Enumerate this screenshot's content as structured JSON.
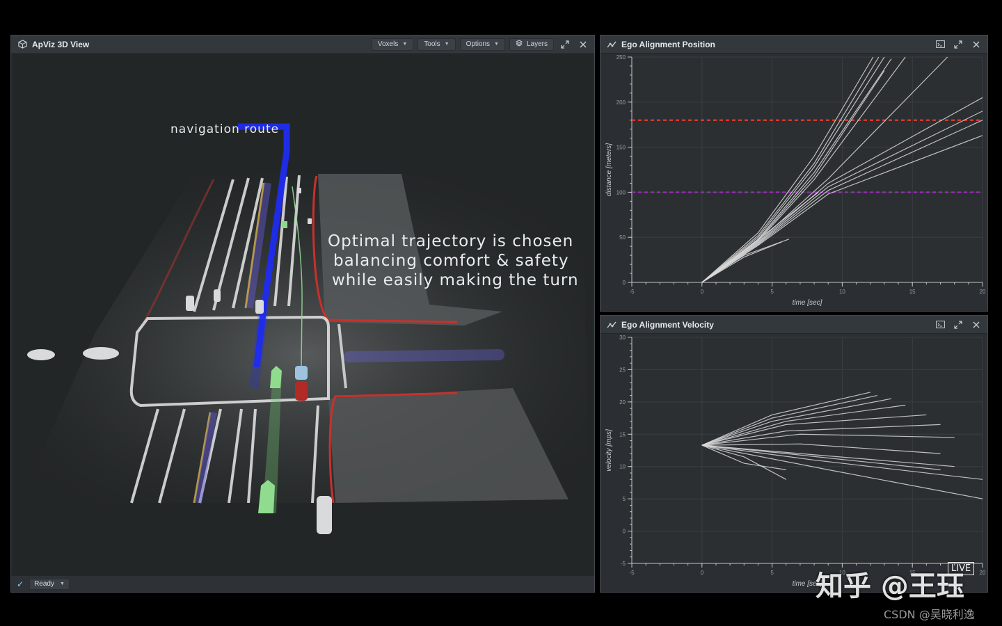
{
  "viewer": {
    "title": "ApViz 3D View",
    "menus": [
      {
        "label": "Voxels"
      },
      {
        "label": "Tools"
      },
      {
        "label": "Options"
      },
      {
        "label": "Layers"
      }
    ],
    "annotation_route": "navigation route",
    "caption_lines": [
      "Optimal trajectory is chosen",
      "balancing comfort & safety",
      "while easily making the turn"
    ],
    "status": "Ready"
  },
  "position_panel": {
    "title": "Ego Alignment Position"
  },
  "velocity_panel": {
    "title": "Ego Alignment Velocity"
  },
  "colors": {
    "panel_bg": "#2b2f33",
    "route_blue": "#1f2cf0",
    "limit_red": "#ff3b2e",
    "limit_purple": "#9b2fb8",
    "trajectory": "#d9d9d9",
    "boundary_red": "#c8312c"
  },
  "icons": [
    "cube-icon",
    "chart-icon",
    "expand-icon",
    "close-icon",
    "console-icon",
    "layers-icon",
    "check-icon"
  ],
  "chart_data": [
    {
      "type": "line",
      "title": "",
      "xlabel": "time [sec]",
      "ylabel": "distance [meters]",
      "xlim": [
        -5,
        20
      ],
      "ylim": [
        0,
        250
      ],
      "xticks": [
        -5,
        0,
        5,
        10,
        15,
        20
      ],
      "yticks": [
        0,
        50,
        100,
        150,
        200,
        250
      ],
      "reference_lines": [
        {
          "y": 180,
          "color": "#ff3b2e",
          "style": "dashed"
        },
        {
          "y": 100,
          "color": "#9b2fb8",
          "style": "dashed"
        }
      ],
      "series": [
        {
          "x": [
            0,
            4,
            8,
            12.2
          ],
          "y": [
            0,
            55,
            140,
            250
          ]
        },
        {
          "x": [
            0,
            4,
            8,
            12.6
          ],
          "y": [
            0,
            52,
            132,
            250
          ]
        },
        {
          "x": [
            0,
            4,
            8,
            13.0
          ],
          "y": [
            0,
            50,
            128,
            250
          ]
        },
        {
          "x": [
            0,
            4,
            8,
            13.5
          ],
          "y": [
            0,
            48,
            122,
            248
          ]
        },
        {
          "x": [
            0,
            4,
            8,
            13.0
          ],
          "y": [
            0,
            47,
            118,
            235
          ]
        },
        {
          "x": [
            0,
            4,
            8,
            14.5
          ],
          "y": [
            0,
            46,
            114,
            250
          ]
        },
        {
          "x": [
            0,
            4,
            9,
            17.5
          ],
          "y": [
            0,
            45,
            115,
            250
          ]
        },
        {
          "x": [
            0,
            4,
            9,
            20
          ],
          "y": [
            0,
            44,
            110,
            205
          ]
        },
        {
          "x": [
            0,
            4,
            9,
            20
          ],
          "y": [
            0,
            43,
            106,
            190
          ]
        },
        {
          "x": [
            0,
            4,
            9,
            20
          ],
          "y": [
            0,
            42,
            102,
            180
          ]
        },
        {
          "x": [
            0,
            4,
            9,
            20
          ],
          "y": [
            0,
            41,
            98,
            163
          ]
        },
        {
          "x": [
            0,
            3,
            6,
            8.3
          ],
          "y": [
            0,
            35,
            72,
            100
          ]
        },
        {
          "x": [
            0,
            3,
            5.7
          ],
          "y": [
            0,
            28,
            45
          ]
        },
        {
          "x": [
            0,
            3,
            6.2
          ],
          "y": [
            0,
            30,
            48
          ]
        }
      ]
    },
    {
      "type": "line",
      "title": "",
      "xlabel": "time [sec]",
      "ylabel": "velocity [mps]",
      "xlim": [
        -5,
        20
      ],
      "ylim": [
        -5,
        30
      ],
      "xticks": [
        -5,
        0,
        5,
        10,
        15,
        20
      ],
      "yticks": [
        -5,
        0,
        5,
        10,
        15,
        20,
        25,
        30
      ],
      "series": [
        {
          "x": [
            0,
            5,
            12
          ],
          "y": [
            13.3,
            18,
            21.5
          ]
        },
        {
          "x": [
            0,
            5,
            12.5
          ],
          "y": [
            13.3,
            17.5,
            21
          ]
        },
        {
          "x": [
            0,
            5,
            13.5
          ],
          "y": [
            13.3,
            17,
            20.5
          ]
        },
        {
          "x": [
            0,
            6,
            14.5
          ],
          "y": [
            13.3,
            17,
            19.5
          ]
        },
        {
          "x": [
            0,
            6,
            16
          ],
          "y": [
            13.3,
            16.5,
            18
          ]
        },
        {
          "x": [
            0,
            6,
            17
          ],
          "y": [
            13.3,
            15.5,
            16.5
          ]
        },
        {
          "x": [
            0,
            7,
            18
          ],
          "y": [
            13.3,
            15,
            14.5
          ]
        },
        {
          "x": [
            0,
            7,
            17
          ],
          "y": [
            13.3,
            13.5,
            12
          ]
        },
        {
          "x": [
            0,
            7,
            18
          ],
          "y": [
            13.3,
            12,
            10
          ]
        },
        {
          "x": [
            0,
            8,
            20
          ],
          "y": [
            13.3,
            11,
            8
          ]
        },
        {
          "x": [
            0,
            9,
            20
          ],
          "y": [
            13.3,
            9.5,
            5
          ]
        },
        {
          "x": [
            0,
            6,
            17
          ],
          "y": [
            13.3,
            12,
            9.5
          ]
        },
        {
          "x": [
            0,
            3,
            6
          ],
          "y": [
            13.3,
            10.5,
            9.5
          ]
        },
        {
          "x": [
            0,
            3,
            6
          ],
          "y": [
            13.3,
            11.5,
            8
          ]
        }
      ]
    }
  ],
  "watermark": {
    "zhihu": "知乎 @王珏",
    "csdn": "CSDN @吴晓利逸",
    "live": "LIVE"
  }
}
